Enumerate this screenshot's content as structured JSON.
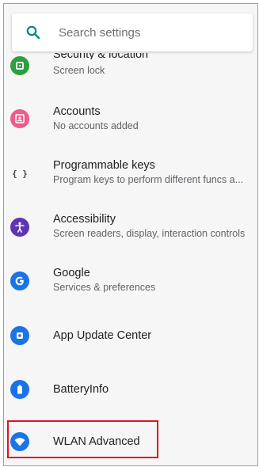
{
  "search": {
    "placeholder": "Search settings",
    "icon": "search-icon",
    "icon_color": "#00897b"
  },
  "items": [
    {
      "title": "Security & location",
      "subtitle": "Screen lock",
      "icon": "lock-icon",
      "color": "#2e9e3e"
    },
    {
      "title": "Accounts",
      "subtitle": "No accounts added",
      "icon": "account-icon",
      "color": "#ef5b8a"
    },
    {
      "title": "Programmable keys",
      "subtitle": "Program keys to perform different funcs a...",
      "icon": "braces-icon",
      "color": "#444444"
    },
    {
      "title": "Accessibility",
      "subtitle": "Screen readers, display, interaction controls",
      "icon": "accessibility-icon",
      "color": "#5e35b1"
    },
    {
      "title": "Google",
      "subtitle": "Services & preferences",
      "icon": "google-icon",
      "color": "#1a73e8"
    },
    {
      "title": "App Update Center",
      "subtitle": "",
      "icon": "gear-icon",
      "color": "#1a73e8"
    },
    {
      "title": "BatteryInfo",
      "subtitle": "",
      "icon": "battery-icon",
      "color": "#1a73e8"
    },
    {
      "title": "WLAN Advanced",
      "subtitle": "",
      "icon": "wifi-icon",
      "color": "#1a73e8"
    }
  ],
  "highlight_color": "#e0131e"
}
